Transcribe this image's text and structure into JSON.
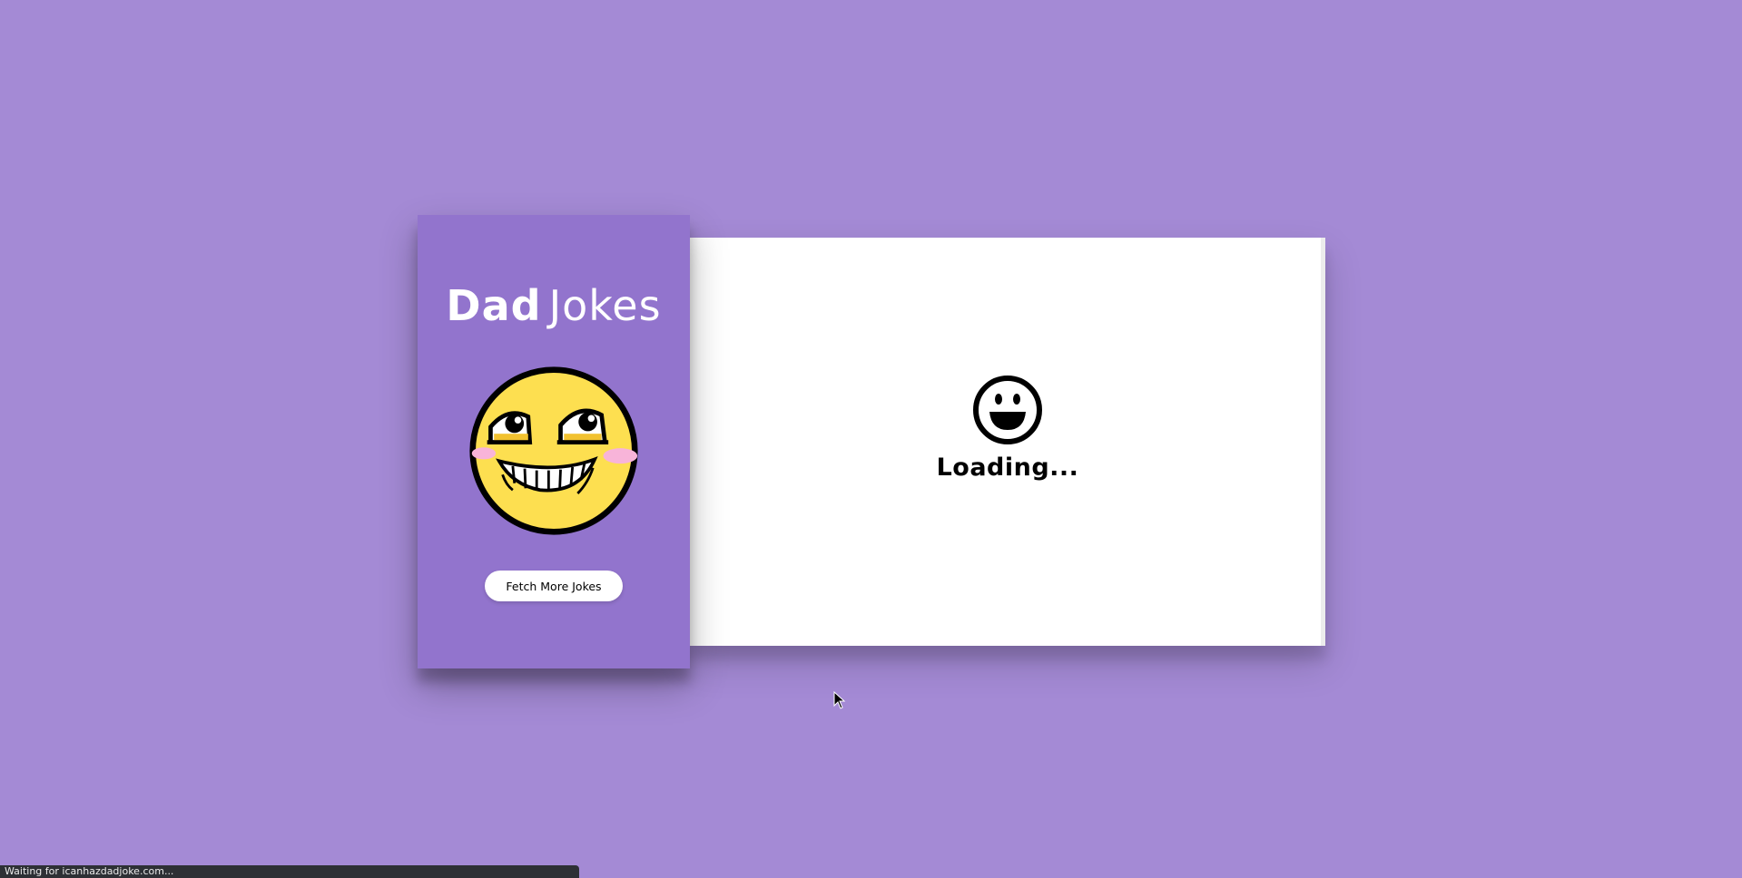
{
  "sidebar": {
    "title_bold": "Dad",
    "title_light": "Jokes",
    "emoji_icon": "awesome-smiley-face",
    "fetch_button_label": "Fetch More Jokes"
  },
  "panel": {
    "loader_icon": "laughing-face-icon",
    "loading_text": "Loading..."
  },
  "status_bar": {
    "text": "Waiting for icanhazdadjoke.com..."
  },
  "colors": {
    "page_background": "#a48ad5",
    "sidebar_background": "#9274cd",
    "panel_background": "#ffffff",
    "button_background": "#ffffff",
    "emoji_yellow": "#fddf50",
    "emoji_blush": "#f8b4d9",
    "status_bar_background": "#2d3035"
  }
}
